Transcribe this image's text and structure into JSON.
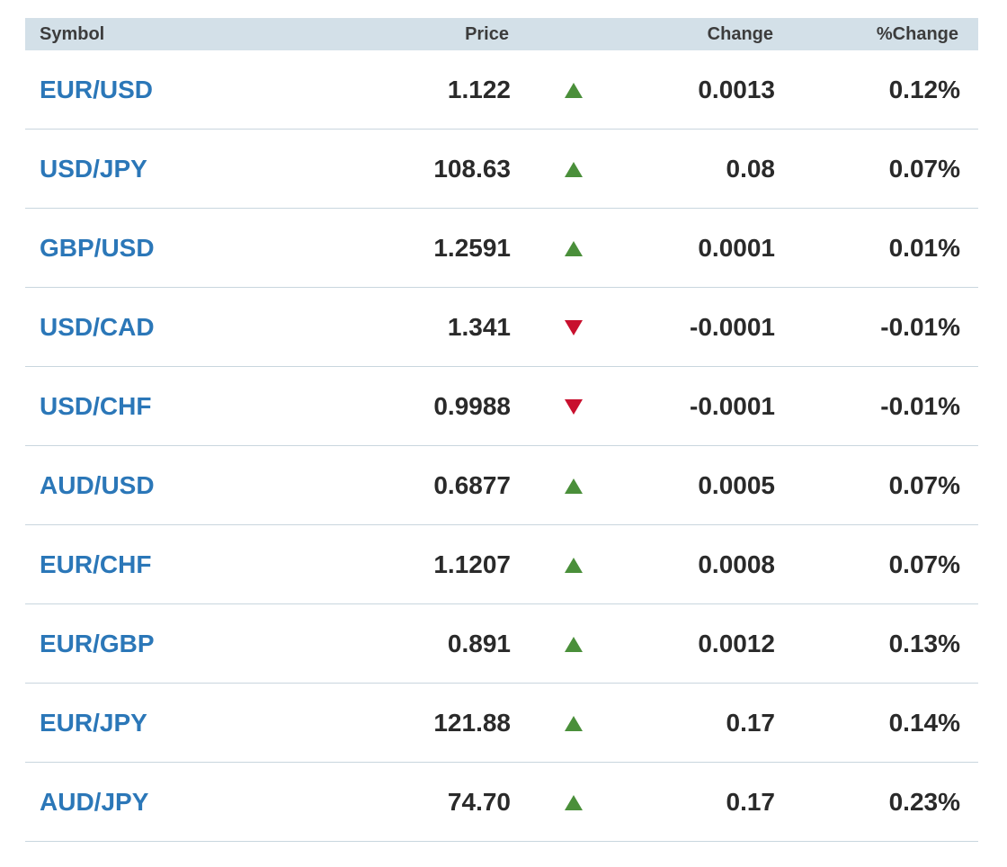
{
  "table": {
    "headers": {
      "symbol": "Symbol",
      "price": "Price",
      "change": "Change",
      "pct_change": "%Change"
    },
    "colors": {
      "header_bg": "#d3e0e8",
      "symbol_link": "#2b77b8",
      "up": "#4a8f3a",
      "down": "#c8102e"
    },
    "rows": [
      {
        "symbol": "EUR/USD",
        "price": "1.122",
        "direction": "up",
        "change": "0.0013",
        "pct_change": "0.12%"
      },
      {
        "symbol": "USD/JPY",
        "price": "108.63",
        "direction": "up",
        "change": "0.08",
        "pct_change": "0.07%"
      },
      {
        "symbol": "GBP/USD",
        "price": "1.2591",
        "direction": "up",
        "change": "0.0001",
        "pct_change": "0.01%"
      },
      {
        "symbol": "USD/CAD",
        "price": "1.341",
        "direction": "down",
        "change": "-0.0001",
        "pct_change": "-0.01%"
      },
      {
        "symbol": "USD/CHF",
        "price": "0.9988",
        "direction": "down",
        "change": "-0.0001",
        "pct_change": "-0.01%"
      },
      {
        "symbol": "AUD/USD",
        "price": "0.6877",
        "direction": "up",
        "change": "0.0005",
        "pct_change": "0.07%"
      },
      {
        "symbol": "EUR/CHF",
        "price": "1.1207",
        "direction": "up",
        "change": "0.0008",
        "pct_change": "0.07%"
      },
      {
        "symbol": "EUR/GBP",
        "price": "0.891",
        "direction": "up",
        "change": "0.0012",
        "pct_change": "0.13%"
      },
      {
        "symbol": "EUR/JPY",
        "price": "121.88",
        "direction": "up",
        "change": "0.17",
        "pct_change": "0.14%"
      },
      {
        "symbol": "AUD/JPY",
        "price": "74.70",
        "direction": "up",
        "change": "0.17",
        "pct_change": "0.23%"
      }
    ]
  }
}
